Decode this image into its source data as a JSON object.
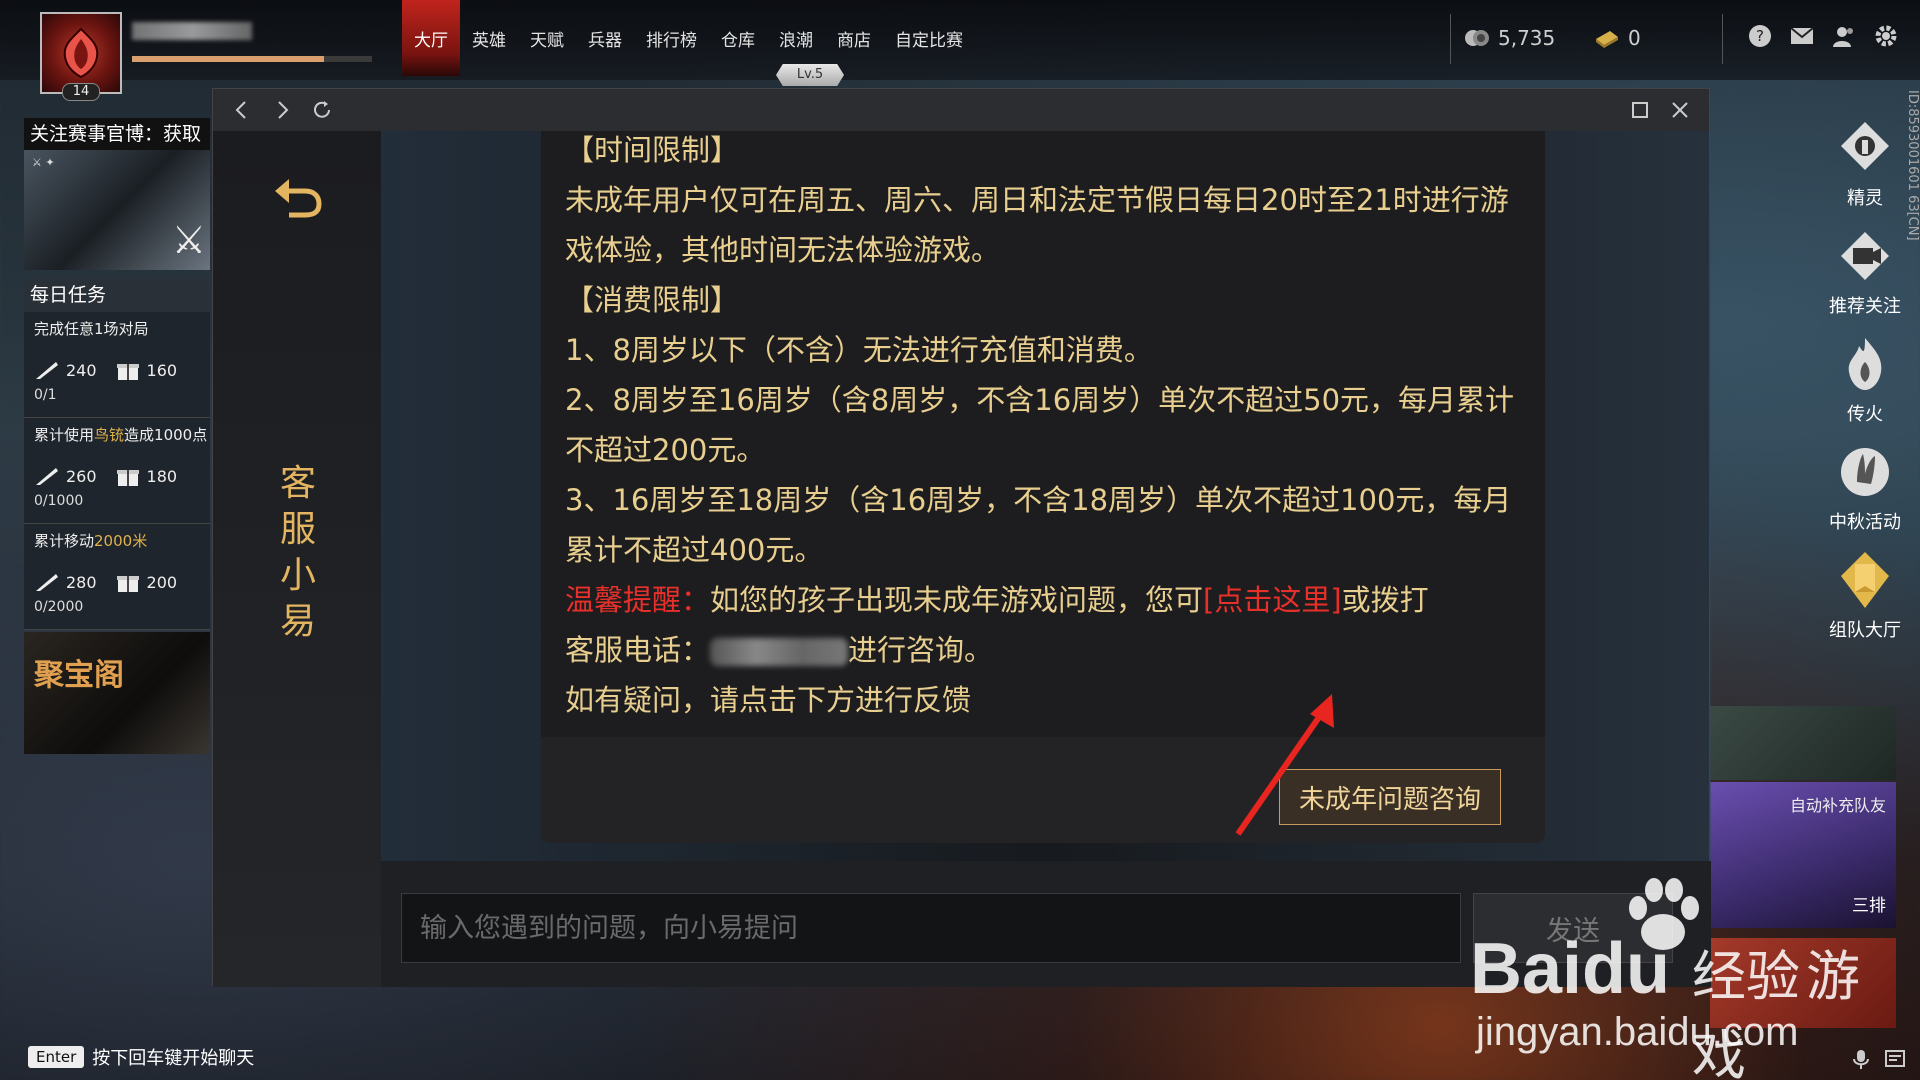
{
  "player": {
    "level": "14",
    "rank_tag": "Lv.5"
  },
  "nav": {
    "items": [
      "大厅",
      "英雄",
      "天赋",
      "兵器",
      "排行榜",
      "仓库",
      "浪潮",
      "商店",
      "自定比赛"
    ],
    "active": "大厅"
  },
  "currencies": {
    "coins": "5,735",
    "tickets": "0"
  },
  "top_icons": [
    "help-icon",
    "mail-icon",
    "friends-icon",
    "settings-icon"
  ],
  "left_panel": {
    "promo_title": "关注赛事官博：获取",
    "tasks_title": "每日任务",
    "tasks": [
      {
        "desc": "完成任意1场对局",
        "reward_a": "240",
        "reward_b": "160",
        "progress": "0/1"
      },
      {
        "desc_pre": "累计使用",
        "desc_hl": "鸟铳",
        "desc_post": "造成1000点",
        "reward_a": "260",
        "reward_b": "180",
        "progress": "0/1000"
      },
      {
        "desc_pre": "累计移动",
        "desc_hl": "2000米",
        "desc_post": "",
        "reward_a": "280",
        "reward_b": "200",
        "progress": "0/2000"
      }
    ],
    "treasure": "聚宝阁"
  },
  "right_side": {
    "items": [
      "精灵",
      "推荐关注",
      "传火",
      "中秋活动",
      "组队大厅"
    ],
    "id_text": "ID:8593001601 63[CN]",
    "card_top": "自动补充队友",
    "card_bottom": "三排"
  },
  "assistant": {
    "name": "客服小易"
  },
  "message": {
    "h_time": "【时间限制】",
    "p_time": "未成年用户仅可在周五、周六、周日和法定节假日每日20时至21时进行游戏体验，其他时间无法体验游戏。",
    "h_spend": "【消费限制】",
    "p1": "1、8周岁以下（不含）无法进行充值和消费。",
    "p2": "2、8周岁至16周岁（含8周岁，不含16周岁）单次不超过50元，每月累计不超过200元。",
    "p3": "3、16周岁至18周岁（含16周岁，不含18周岁）单次不超过100元，每月累计不超过400元。",
    "tip_label": "温馨提醒：",
    "tip_text": "如您的孩子出现未成年游戏问题，您可",
    "tip_link": "[点击这里]",
    "tip_after": "或拨打",
    "phone_label": "客服电话：",
    "phone_after": "进行咨询。",
    "p_last": "如有疑问，请点击下方进行反馈",
    "button": "未成年问题咨询"
  },
  "input": {
    "placeholder": "输入您遇到的问题，向小易提问",
    "send": "发送"
  },
  "bottom": {
    "key": "Enter",
    "hint": "按下回车键开始聊天"
  },
  "watermark": {
    "brand": "Bai",
    "brand2": "du",
    "cn": "经验",
    "url": "jingyan.baidu.com",
    "overlay": "游戏"
  }
}
